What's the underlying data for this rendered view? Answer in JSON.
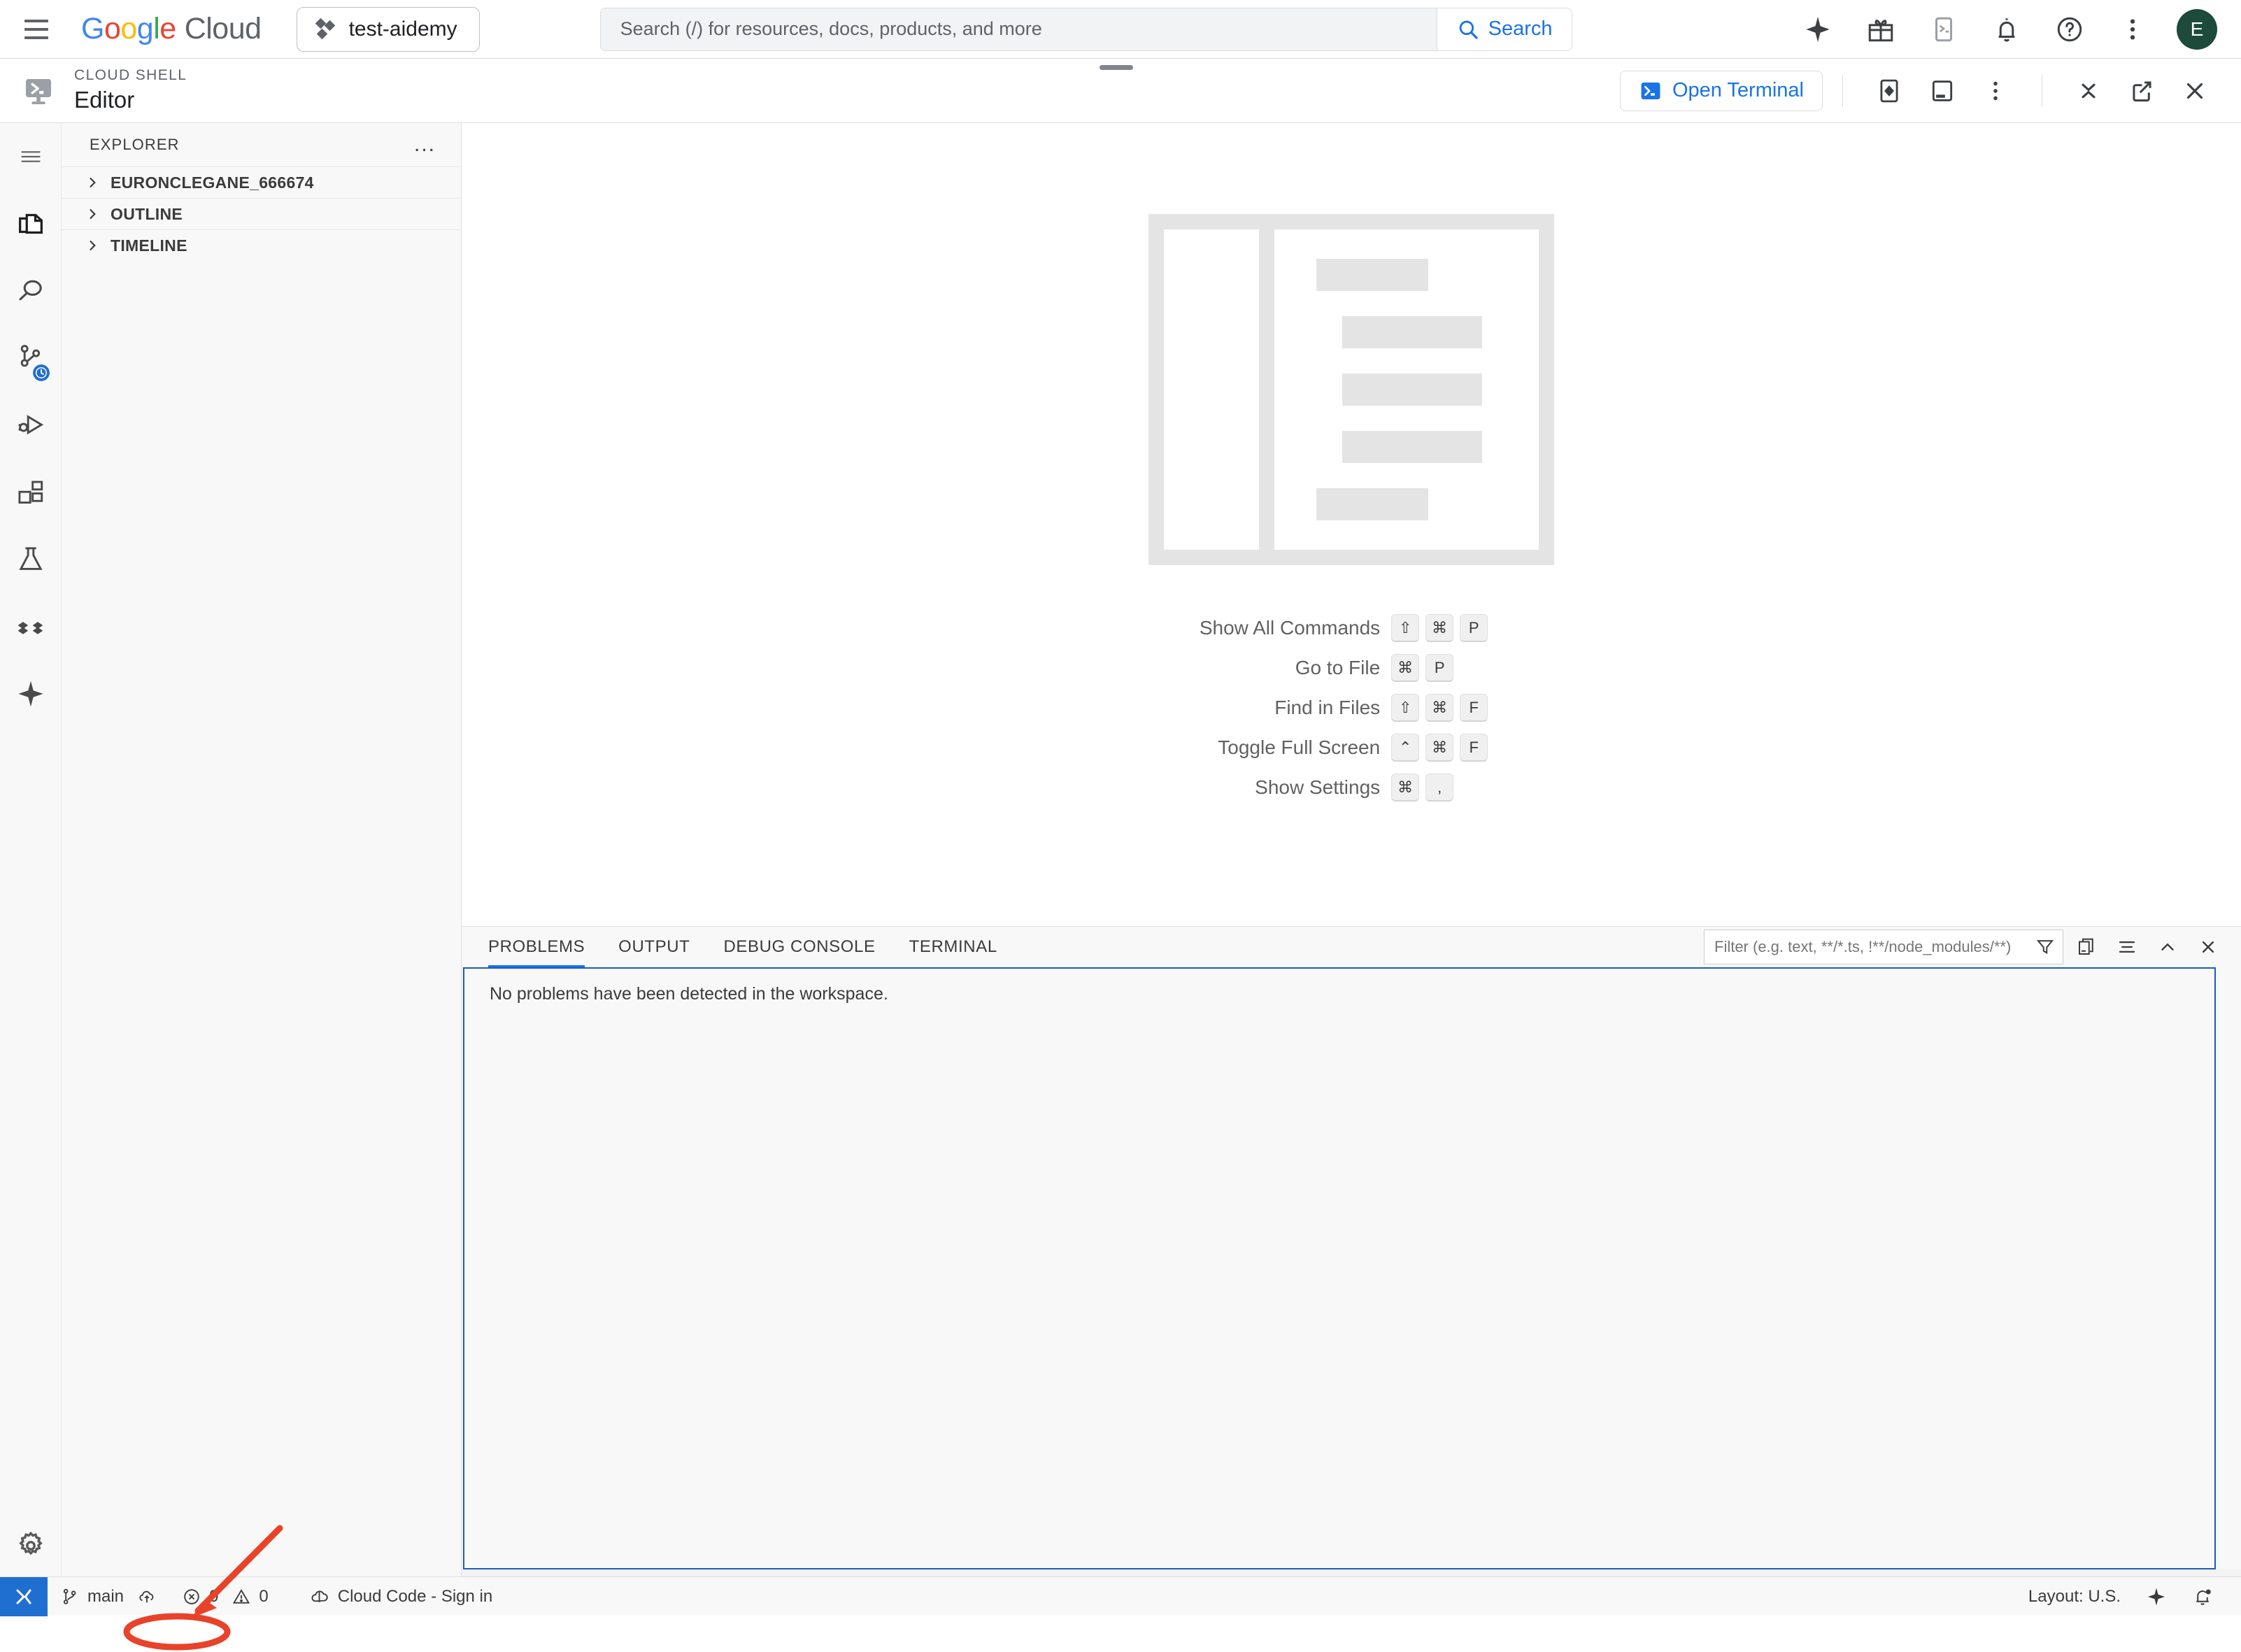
{
  "topbar": {
    "logo_google": "Google",
    "logo_cloud": "Cloud",
    "project_name": "test-aidemy",
    "search_placeholder": "Search (/) for resources, docs, products, and more",
    "search_value": "",
    "search_button_label": "Search",
    "avatar_initial": "E",
    "icons": [
      "gemini-sparkle-icon",
      "gift-icon",
      "cloud-shell-icon",
      "notifications-bell-icon",
      "help-icon",
      "more-options-icon"
    ]
  },
  "cloudshell": {
    "eyebrow": "CLOUD SHELL",
    "title": "Editor",
    "open_terminal_label": "Open Terminal",
    "actions": [
      "preview-icon",
      "new-editor-window-icon",
      "more-actions-icon",
      "minimize-icon",
      "open-new-window-icon",
      "close-icon"
    ]
  },
  "activity_bar": {
    "items": [
      {
        "name": "menu-icon",
        "label": "Menu"
      },
      {
        "name": "explorer-icon",
        "label": "Explorer"
      },
      {
        "name": "search-icon",
        "label": "Search"
      },
      {
        "name": "source-control-icon",
        "label": "Source Control"
      },
      {
        "name": "run-and-debug-icon",
        "label": "Run and Debug"
      },
      {
        "name": "extensions-icon",
        "label": "Extensions"
      },
      {
        "name": "testing-icon",
        "label": "Testing"
      },
      {
        "name": "cloud-code-icon",
        "label": "Cloud Code"
      },
      {
        "name": "gemini-code-assist-icon",
        "label": "Gemini Code Assist"
      }
    ],
    "settings_label": "Manage"
  },
  "sidebar": {
    "title": "EXPLORER",
    "more_label": "...",
    "sections": [
      {
        "label": "EURONCLEGANE_666674",
        "expanded": false
      },
      {
        "label": "OUTLINE",
        "expanded": false
      },
      {
        "label": "TIMELINE",
        "expanded": false
      }
    ]
  },
  "editor": {
    "shortcuts": [
      {
        "label": "Show All Commands",
        "keys": [
          "⇧",
          "⌘",
          "P"
        ]
      },
      {
        "label": "Go to File",
        "keys": [
          "⌘",
          "P"
        ]
      },
      {
        "label": "Find in Files",
        "keys": [
          "⇧",
          "⌘",
          "F"
        ]
      },
      {
        "label": "Toggle Full Screen",
        "keys": [
          "⌃",
          "⌘",
          "F"
        ]
      },
      {
        "label": "Show Settings",
        "keys": [
          "⌘",
          ","
        ]
      }
    ]
  },
  "panel": {
    "tabs": [
      {
        "label": "PROBLEMS",
        "active": true
      },
      {
        "label": "OUTPUT",
        "active": false
      },
      {
        "label": "DEBUG CONSOLE",
        "active": false
      },
      {
        "label": "TERMINAL",
        "active": false
      }
    ],
    "filter_placeholder": "Filter (e.g. text, **/*.ts, !**/node_modules/**)",
    "filter_value": "",
    "message": "No problems have been detected in the workspace.",
    "buttons": [
      "filter-icon",
      "collapse-all-icon",
      "view-as-table-icon",
      "chevron-up-icon",
      "close-panel-icon"
    ]
  },
  "statusbar": {
    "remote_label": "Open a Remote Window",
    "branch": "main",
    "errors": "0",
    "warnings": "0",
    "cloud_code": "Cloud Code - Sign in",
    "layout": "Layout: U.S.",
    "right_icons": [
      "gemini-sparkle-icon",
      "notifications-bell-icon"
    ]
  },
  "annotation": {
    "color": "#E8432A",
    "highlight_target": "Cloud Code - Sign in"
  }
}
